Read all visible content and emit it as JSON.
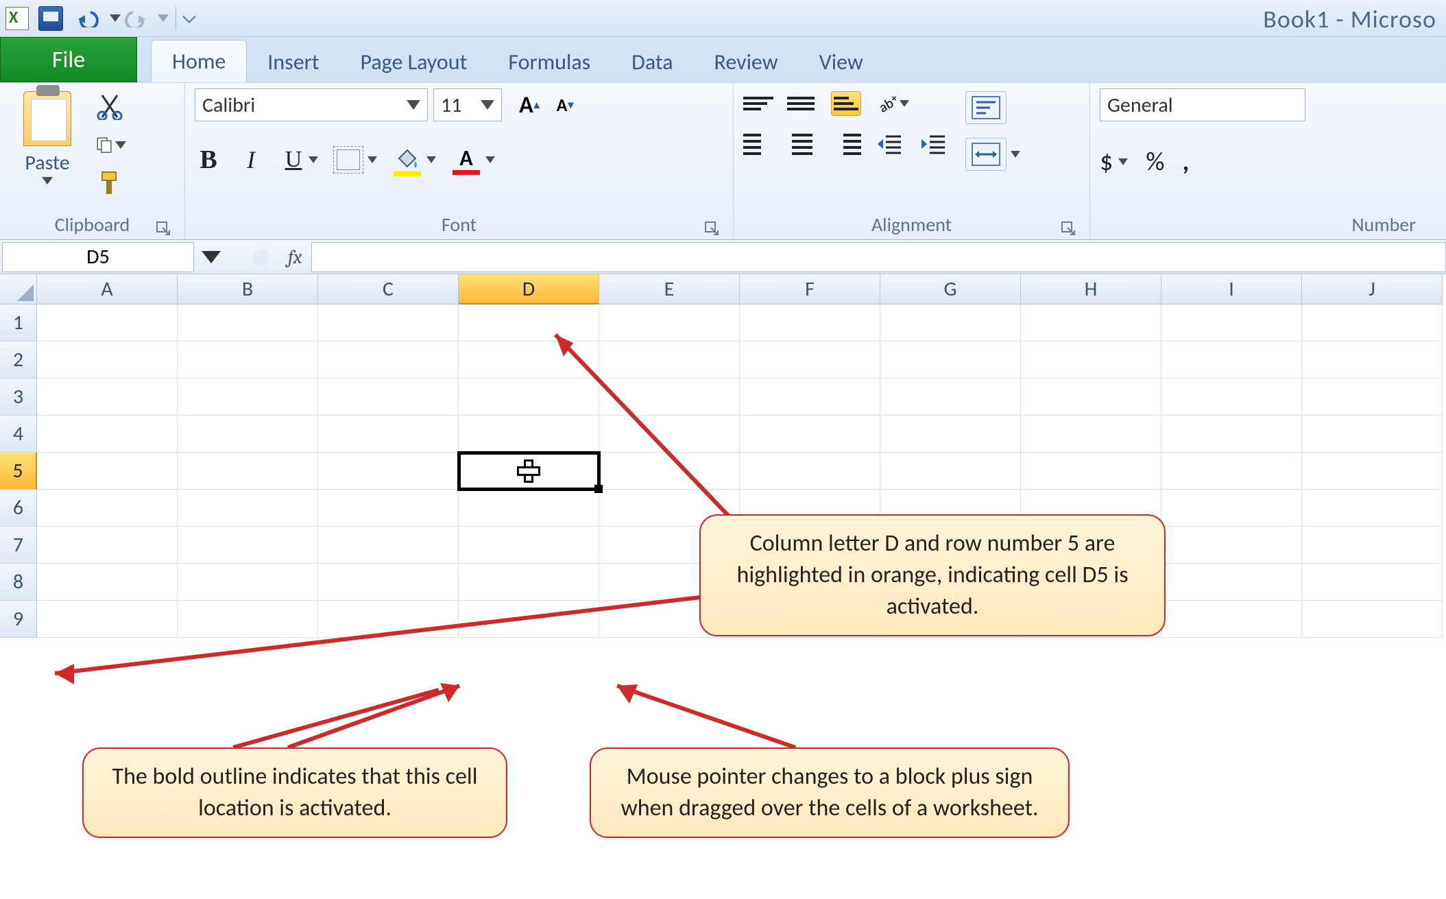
{
  "window_title": "Book1 - Microso",
  "tabs": {
    "file": "File",
    "items": [
      "Home",
      "Insert",
      "Page Layout",
      "Formulas",
      "Data",
      "Review",
      "View"
    ],
    "active": "Home"
  },
  "ribbon": {
    "clipboard": {
      "label": "Clipboard",
      "paste": "Paste"
    },
    "font": {
      "label": "Font",
      "name": "Calibri",
      "size": "11",
      "bold": "B",
      "italic": "I",
      "underline": "U",
      "font_color_letter": "A"
    },
    "alignment": {
      "label": "Alignment"
    },
    "number": {
      "label": "Number",
      "format": "General",
      "currency": "$",
      "percent": "%",
      "comma": ","
    }
  },
  "namebox": "D5",
  "fx": "fx",
  "columns": [
    "A",
    "B",
    "C",
    "D",
    "E",
    "F",
    "G",
    "H",
    "I",
    "J"
  ],
  "rows": [
    "1",
    "2",
    "3",
    "4",
    "5",
    "6",
    "7",
    "8",
    "9"
  ],
  "active_col": "D",
  "active_row": "5",
  "callouts": {
    "c1": "Column letter D and row number 5 are highlighted in orange, indicating cell D5 is activated.",
    "c2": "The bold outline indicates that this cell location is activated.",
    "c3": "Mouse pointer changes to a block plus sign when dragged over the cells of a worksheet."
  }
}
